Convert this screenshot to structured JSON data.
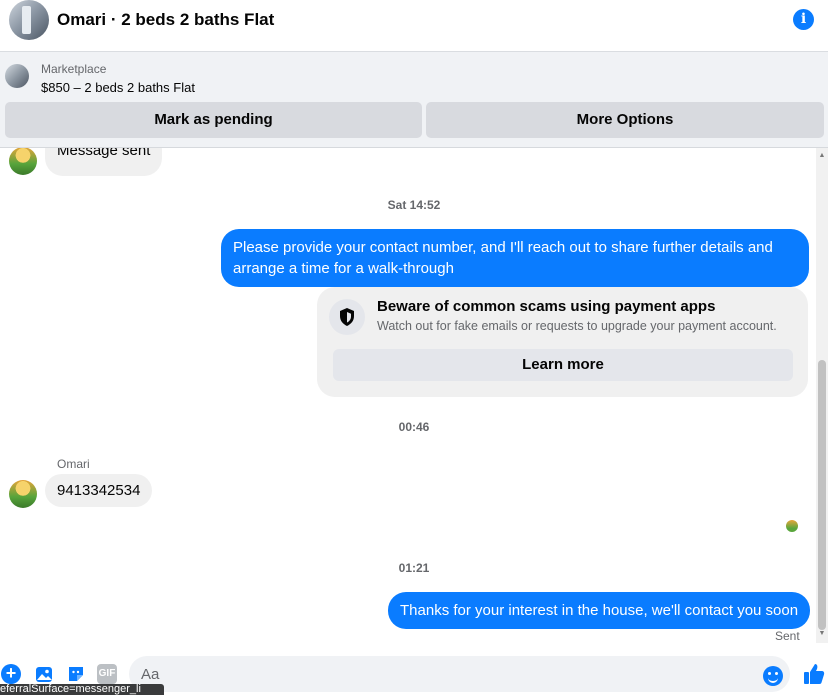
{
  "header": {
    "title": "Omari · 2 beds 2 baths Flat",
    "icon": "info-icon"
  },
  "marketplace": {
    "label": "Marketplace",
    "listing": "$850 – 2 beds 2 baths Flat",
    "mark_pending": "Mark as pending",
    "more_options": "More Options"
  },
  "conversation": {
    "first_message": "Message sent",
    "time_1": "Sat 14:52",
    "outgoing_1": "Please provide your contact number, and I'll reach out to share further details and arrange a time for a walk-through",
    "scam_card": {
      "title": "Beware of common scams using payment apps",
      "description": "Watch out for fake emails or requests to upgrade your payment account.",
      "button": "Learn more"
    },
    "time_2": "00:46",
    "sender_name": "Omari",
    "incoming_1": "9413342534",
    "time_3": "01:21",
    "outgoing_2": "Thanks for your interest in the house, we'll contact you soon",
    "status": "Sent"
  },
  "composer": {
    "placeholder": "Aa"
  },
  "tooltip": "eferralSurface=messenger_li",
  "colors": {
    "accent": "#0a7cff",
    "incoming_bubble": "#f0f0f0",
    "secondary_text": "#65676b"
  }
}
